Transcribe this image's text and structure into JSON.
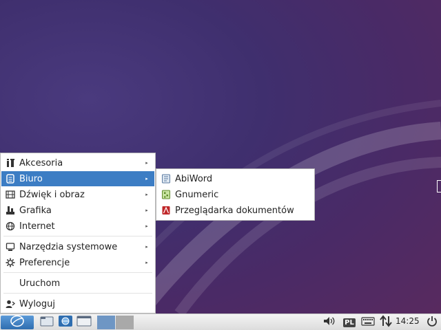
{
  "menu": {
    "items": [
      {
        "label": "Akcesoria",
        "icon": "accessories-icon",
        "has_submenu": true
      },
      {
        "label": "Biuro",
        "icon": "office-icon",
        "has_submenu": true,
        "selected": true
      },
      {
        "label": "Dźwięk i obraz",
        "icon": "multimedia-icon",
        "has_submenu": true
      },
      {
        "label": "Grafika",
        "icon": "graphics-icon",
        "has_submenu": true
      },
      {
        "label": "Internet",
        "icon": "internet-icon",
        "has_submenu": true
      },
      {
        "label": "Narzędzia systemowe",
        "icon": "system-tools-icon",
        "has_submenu": true
      },
      {
        "label": "Preferencje",
        "icon": "preferences-icon",
        "has_submenu": true
      },
      {
        "label": "Uruchom",
        "icon": "",
        "has_submenu": false
      },
      {
        "label": "Wyloguj",
        "icon": "logout-icon",
        "has_submenu": false
      }
    ],
    "arrow": "▸"
  },
  "submenu": {
    "items": [
      {
        "label": "AbiWord",
        "icon": "abiword-icon"
      },
      {
        "label": "Gnumeric",
        "icon": "gnumeric-icon"
      },
      {
        "label": "Przeglądarka dokumentów",
        "icon": "document-viewer-icon"
      }
    ]
  },
  "taskbar": {
    "clock": "14:25",
    "keyboard_layout": "PL"
  },
  "colors": {
    "highlight": "#3c7dc4",
    "desktop": "#3f2f6e"
  }
}
